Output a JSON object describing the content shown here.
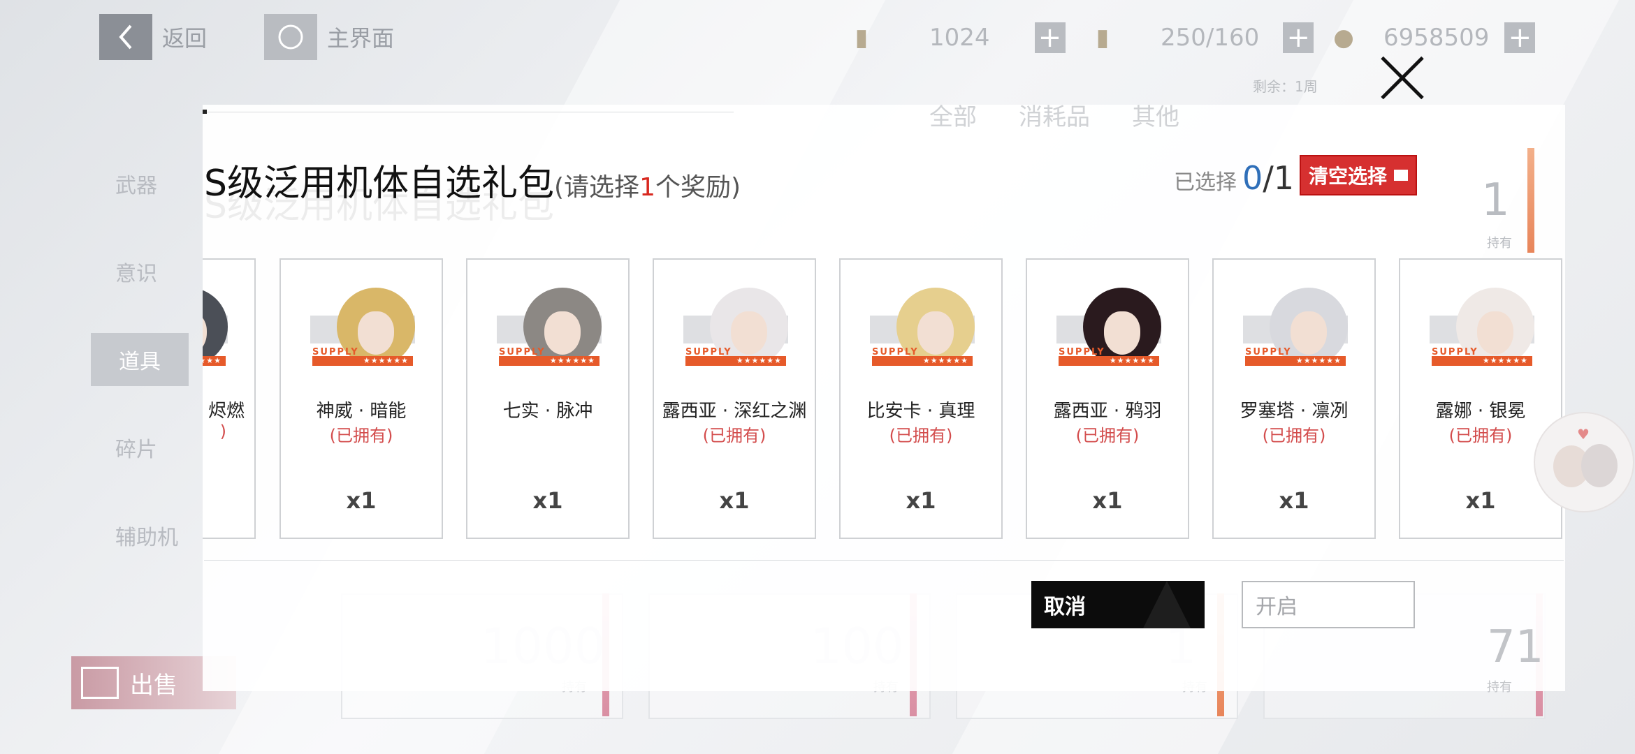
{
  "topbar": {
    "back_label": "返回",
    "home_label": "主界面",
    "resources": [
      {
        "icon": "fuel-cell-icon",
        "value": "1024"
      },
      {
        "icon": "energy-drink-icon",
        "value": "250/160"
      },
      {
        "icon": "coin-icon",
        "value": "6958509"
      }
    ],
    "plus_label": "+"
  },
  "sidebar": {
    "items": [
      {
        "label": "武器"
      },
      {
        "label": "意识"
      },
      {
        "label": "道具"
      },
      {
        "label": "碎片"
      },
      {
        "label": "辅助机"
      }
    ]
  },
  "sell_label": "出售",
  "background_cards": {
    "holding_label": "持有",
    "values": [
      "1",
      "1000",
      "100",
      "1",
      "71"
    ],
    "remaining": "剩余：1周",
    "filters": [
      "全部",
      "消耗品",
      "其他"
    ]
  },
  "dialog": {
    "title": "S级泛用机体自选礼包",
    "subtitle_prefix": "(请选择",
    "subtitle_num": "1",
    "subtitle_suffix": "个奖励)",
    "selected_label": "已选择",
    "selected_current": "0",
    "selected_total": "/1",
    "clear_label": "清空选择",
    "cancel_label": "取消",
    "open_label": "开启",
    "cards": [
      {
        "name": "烬燃",
        "owned": ")",
        "qty": "",
        "hair": "#4b4f57",
        "supply": "★★★"
      },
      {
        "name": "神威 · 暗能",
        "owned": "(已拥有)",
        "qty": "x1",
        "hair": "#d9b768",
        "supply": "★★★★★★"
      },
      {
        "name": "七实 · 脉冲",
        "owned": "",
        "qty": "x1",
        "hair": "#8c8884",
        "supply": "★★★★★★"
      },
      {
        "name": "露西亚 · 深红之渊",
        "owned": "(已拥有)",
        "qty": "x1",
        "hair": "#e9e6e8",
        "supply": "★★★★★★"
      },
      {
        "name": "比安卡 · 真理",
        "owned": "(已拥有)",
        "qty": "x1",
        "hair": "#e6cf8e",
        "supply": "★★★★★★"
      },
      {
        "name": "露西亚 · 鸦羽",
        "owned": "(已拥有)",
        "qty": "x1",
        "hair": "#2a1a1e",
        "supply": "★★★★★★"
      },
      {
        "name": "罗塞塔 · 凛冽",
        "owned": "(已拥有)",
        "qty": "x1",
        "hair": "#d8d9de",
        "supply": "★★★★★★"
      },
      {
        "name": "露娜 · 银冕",
        "owned": "(已拥有)",
        "qty": "x1",
        "hair": "#efe9e6",
        "supply": "★★★★★★"
      }
    ],
    "supply_word": "SUPPLY"
  }
}
